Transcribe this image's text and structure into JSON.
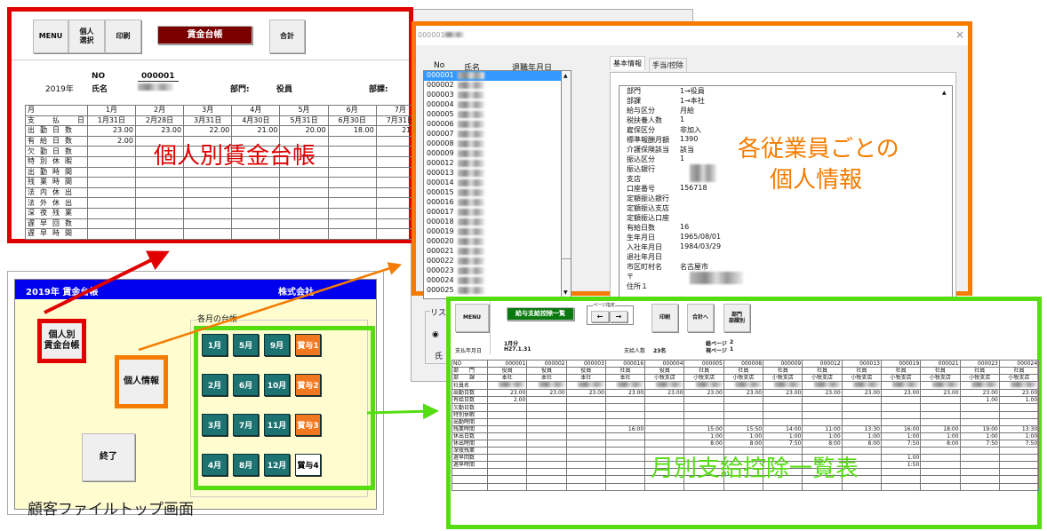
{
  "ledger": {
    "toolbar": [
      "MENU",
      "個人\n選択",
      "印刷"
    ],
    "title": "賃金台帳",
    "total": "合計",
    "no_label": "NO",
    "no_value": "000001",
    "year": "2019年",
    "name_label": "氏名",
    "dept_label": "部門:",
    "dept_value": "役員",
    "section_label": "部課:",
    "month_header": "月",
    "months": [
      "1月",
      "2月",
      "3月",
      "4月",
      "5月",
      "6月",
      "7月"
    ],
    "row_labels": [
      "支　払　日",
      "出勤日数",
      "有給日数",
      "欠勤日数",
      "特別休暇",
      "出勤時間",
      "残業時間",
      "法内休出",
      "法外休出",
      "深夜残業",
      "遅早回数",
      "遅早時間"
    ],
    "pay_dates": [
      "1月31日",
      "2月28日",
      "3月31日",
      "4月30日",
      "5月31日",
      "6月30日",
      "7月31日"
    ],
    "attend_days": [
      "23.00",
      "23.00",
      "22.00",
      "21.00",
      "20.00",
      "18.00",
      "21.00"
    ],
    "paid_leave": [
      "2.00",
      "",
      "",
      "",
      "",
      "",
      ""
    ],
    "caption": "個人別賃金台帳"
  },
  "personal": {
    "title": "000001",
    "close": "×",
    "list_headers": [
      "No",
      "氏名",
      "退職年月日"
    ],
    "ids": [
      "000001",
      "000002",
      "000003",
      "000004",
      "000005",
      "000006",
      "000007",
      "000008",
      "000009",
      "000012",
      "000013",
      "000014",
      "000015",
      "000016",
      "000017",
      "000018",
      "000019",
      "000020",
      "000021",
      "000022",
      "000023",
      "000024",
      "000025"
    ],
    "tabs": [
      "基本情報",
      "手当/控除"
    ],
    "fields": [
      [
        "部門",
        "1→役員"
      ],
      [
        "部課",
        "1→本社"
      ],
      [
        "給与区分",
        "月給"
      ],
      [
        "税扶養人数",
        "1"
      ],
      [
        "雇保区分",
        "非加入"
      ],
      [
        "標準報酬月額",
        "1390"
      ],
      [
        "介護保険該当",
        "該当"
      ],
      [
        "振込区分",
        "1"
      ],
      [
        "振込銀行",
        ""
      ],
      [
        "支店",
        ""
      ],
      [
        "口座番号",
        "156718"
      ],
      [
        "定額振込銀行",
        ""
      ],
      [
        "定額振込支店",
        ""
      ],
      [
        "定額振込口座",
        ""
      ],
      [
        "有給日数",
        "16"
      ],
      [
        "生年月日",
        "1965/08/01"
      ],
      [
        "入社年月日",
        "1984/03/29"
      ],
      [
        "退社年月日",
        ""
      ],
      [
        "市区町村名",
        "名古屋市"
      ],
      [
        "〒",
        ""
      ],
      [
        "住所１",
        ""
      ]
    ],
    "caption1": "各従業員ごとの",
    "caption2": "個人情報",
    "behind_list_label": "リス",
    "behind_name": "氏"
  },
  "top": {
    "title_left": "2019年 賃金台帳",
    "title_right": "株式会社",
    "btn_ledger": "個人別\n賃金台帳",
    "btn_info": "個人情報",
    "btn_exit": "終了",
    "group_label": "各月の台帳",
    "grid": [
      [
        "1月",
        "5月",
        "9月",
        "賞与1"
      ],
      [
        "2月",
        "6月",
        "10月",
        "賞与2"
      ],
      [
        "3月",
        "7月",
        "11月",
        "賞与3"
      ],
      [
        "4月",
        "8月",
        "12月",
        "賞与4"
      ]
    ],
    "caption": "顧客ファイルトップ画面"
  },
  "monthly": {
    "menu": "MENU",
    "title": "給与支給控除一覧",
    "page_group": "ページ指定",
    "prev": "←",
    "next": "→",
    "print": "印刷",
    "to_total": "合計へ",
    "dept": "部門\n部課別",
    "month": "1月分",
    "pay_date_label": "支払年月日",
    "pay_date": "H27.1.31",
    "count_label": "支給人数",
    "count": "23名",
    "total_pages_label": "総ページ",
    "total_pages": "2",
    "cur_page_label": "現ページ",
    "cur_page": "1",
    "row_labels": [
      "NO",
      "部　　門",
      "部　　課",
      "社員名",
      "出勤日数",
      "有給日数",
      "欠勤日数",
      "特別休暇",
      "出勤時間",
      "残業時間",
      "休出日数",
      "休出時間",
      "深夜残業",
      "遅早回数",
      "遅早時間"
    ],
    "nos": [
      "000001",
      "000002",
      "000003",
      "000016",
      "000004",
      "000005",
      "000008",
      "000009",
      "000012",
      "000013",
      "000019",
      "000021",
      "000023",
      "000024"
    ],
    "depts": [
      "役員",
      "役員",
      "役員",
      "社員",
      "役員",
      "社員",
      "社員",
      "社員",
      "社員",
      "社員",
      "社員",
      "社員",
      "社員",
      "社員"
    ],
    "sections": [
      "本社",
      "本社",
      "本社",
      "本社",
      "小牧支店",
      "小牧支店",
      "小牧支店",
      "小牧支店",
      "小牧支店",
      "小牧支店",
      "小牧支店",
      "小牧支店",
      "小牧支店",
      "小牧支店"
    ],
    "attend": [
      "23.00",
      "23.00",
      "23.00",
      "23.00",
      "23.00",
      "23.00",
      "23.00",
      "23.00",
      "23.00",
      "23.00",
      "23.00",
      "23.00",
      "23.00",
      "23.00"
    ],
    "paid": [
      "2.00",
      "",
      "",
      "",
      "",
      "",
      "",
      "",
      "",
      "",
      "",
      "",
      "1.00",
      "1.00"
    ],
    "overtime": [
      "",
      "",
      "",
      "16:00",
      "",
      "15:00",
      "15:50",
      "14:00",
      "11:00",
      "13:30",
      "16:00",
      "18:00",
      "19:00",
      "13:30"
    ],
    "holiday_days": [
      "",
      "",
      "",
      "",
      "",
      "1:00",
      "1:00",
      "1:00",
      "1:00",
      "1:00",
      "1:00",
      "1:00",
      "1:00",
      "1:00"
    ],
    "holiday_hours": [
      "",
      "",
      "",
      "",
      "",
      "8:00",
      "8:00",
      "7:50",
      "8:00",
      "8:00",
      "7:50",
      "8:00",
      "7:50",
      "7:50"
    ],
    "late_count": [
      "",
      "",
      "",
      "",
      "",
      "",
      "",
      "",
      "",
      "",
      "1.00",
      "",
      "",
      ""
    ],
    "late_hours": [
      "",
      "",
      "",
      "",
      "",
      "",
      "",
      "",
      "",
      "",
      "1:50",
      "",
      "",
      ""
    ],
    "caption": "月別支給控除一覧表"
  },
  "colors": {
    "red": "#e00000",
    "orange": "#f57c00",
    "green": "#55dd11",
    "teal": "#1d7371",
    "blue": "#0000ee",
    "maroon": "#7a0000"
  }
}
